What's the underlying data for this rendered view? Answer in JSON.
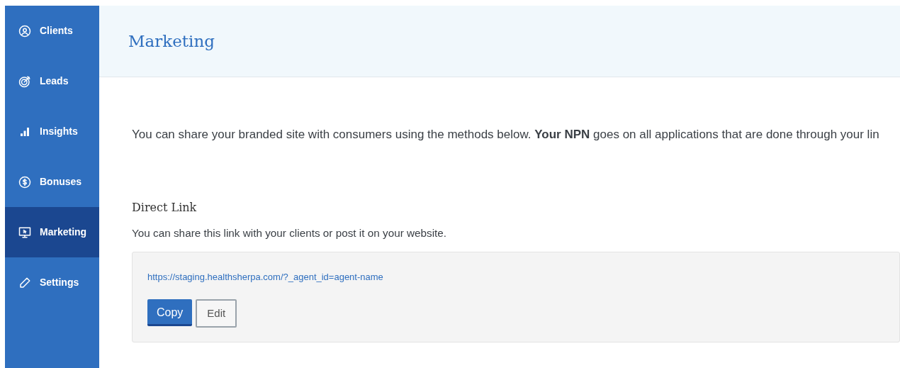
{
  "sidebar": {
    "items": [
      {
        "label": "Clients",
        "selected": false
      },
      {
        "label": "Leads",
        "selected": false
      },
      {
        "label": "Insights",
        "selected": false
      },
      {
        "label": "Bonuses",
        "selected": false
      },
      {
        "label": "Marketing",
        "selected": true
      },
      {
        "label": "Settings",
        "selected": false
      }
    ]
  },
  "header": {
    "title": "Marketing"
  },
  "intro": "You can share your branded site with consumers using the methods below. **Your NPN** goes on all applications that are done through your lin",
  "direct_link": {
    "heading": "Direct Link",
    "description": "You can share this link with your clients or post it on your website.",
    "url": "https://staging.healthsherpa.com/?_agent_id=agent-name",
    "buttons": [
      {
        "label": "Copy",
        "kind": "primary"
      },
      {
        "label": "Edit",
        "kind": "secondary"
      }
    ]
  }
}
